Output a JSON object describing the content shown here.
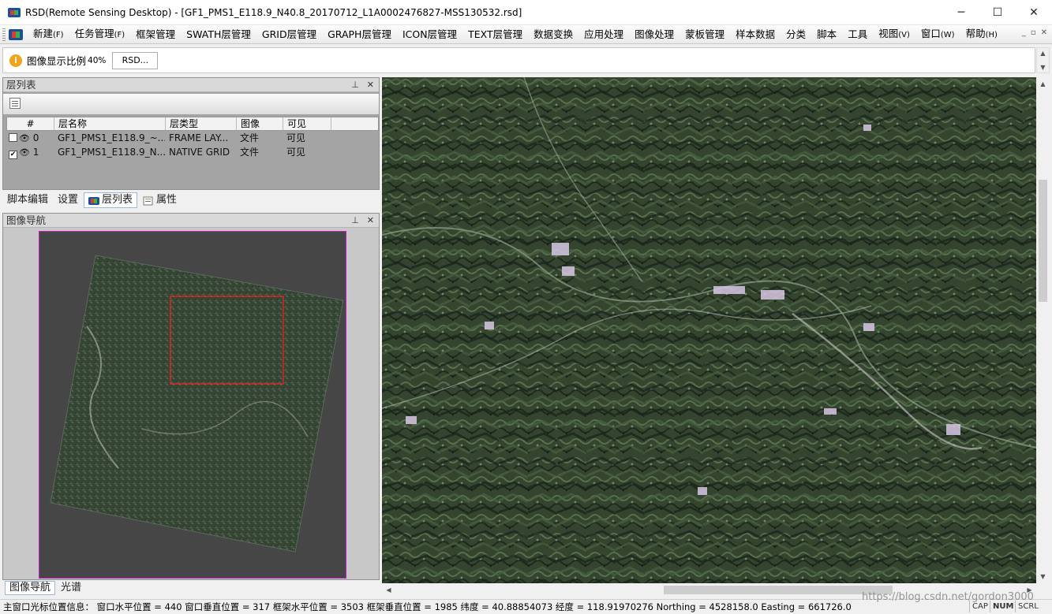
{
  "window": {
    "title": "RSD(Remote Sensing Desktop) - [GF1_PMS1_E118.9_N40.8_20170712_L1A0002476827-MSS130532.rsd]",
    "controls": {
      "minimize": "─",
      "maximize": "☐",
      "close": "✕"
    }
  },
  "menu": {
    "items": [
      {
        "label": "新建",
        "hotkey": "(F)"
      },
      {
        "label": "任务管理",
        "hotkey": "(F)"
      },
      {
        "label": "框架管理",
        "hotkey": ""
      },
      {
        "label": "SWATH层管理",
        "hotkey": ""
      },
      {
        "label": "GRID层管理",
        "hotkey": ""
      },
      {
        "label": "GRAPH层管理",
        "hotkey": ""
      },
      {
        "label": "ICON层管理",
        "hotkey": ""
      },
      {
        "label": "TEXT层管理",
        "hotkey": ""
      },
      {
        "label": "数据变换",
        "hotkey": ""
      },
      {
        "label": "应用处理",
        "hotkey": ""
      },
      {
        "label": "图像处理",
        "hotkey": ""
      },
      {
        "label": "蒙板管理",
        "hotkey": ""
      },
      {
        "label": "样本数据",
        "hotkey": ""
      },
      {
        "label": "分类",
        "hotkey": ""
      },
      {
        "label": "脚本",
        "hotkey": ""
      },
      {
        "label": "工具",
        "hotkey": ""
      },
      {
        "label": "视图",
        "hotkey": "(V)"
      },
      {
        "label": "窗口",
        "hotkey": "(W)"
      },
      {
        "label": "帮助",
        "hotkey": "(H)"
      }
    ],
    "mdi": {
      "minimize": "_",
      "restore": "▫",
      "close": "✕"
    }
  },
  "infobar": {
    "label": "图像显示比例",
    "value": "40%",
    "button": "RSD..."
  },
  "layer_panel": {
    "title": "层列表",
    "buttons": {
      "pin": "⊥",
      "close": "✕"
    },
    "columns": [
      "#",
      "层名称",
      "层类型",
      "图像",
      "可见"
    ],
    "rows": [
      {
        "checked": false,
        "index": "0",
        "name": "GF1_PMS1_E118.9_~...",
        "type": "FRAME LAY...",
        "image": "文件",
        "visible": "可见"
      },
      {
        "checked": true,
        "index": "1",
        "name": "GF1_PMS1_E118.9_N...",
        "type": "NATIVE GRID",
        "image": "文件",
        "visible": "可见"
      }
    ]
  },
  "side_tabs": [
    "脚本编辑",
    "设置",
    "层列表",
    "属性"
  ],
  "nav_panel": {
    "title": "图像导航",
    "buttons": {
      "pin": "⊥",
      "close": "✕"
    }
  },
  "nav_tabs": [
    "图像导航",
    "光谱"
  ],
  "statusbar": {
    "text": "主窗口光标位置信息： 窗口水平位置 = 440 窗口垂直位置 = 317 框架水平位置 = 3503 框架垂直位置 = 1985 纬度 = 40.88854073 经度 = 118.91970276 Northing = 4528158.0 Easting = 661726.0",
    "cap": "CAP",
    "num": "NUM",
    "scrl": "SCRL"
  },
  "watermark": "https://blog.csdn.net/gordon3000",
  "colors": {
    "nav_border": "#c020c0",
    "viewport_box": "#ff2020",
    "info_icon": "#f3a21b"
  }
}
